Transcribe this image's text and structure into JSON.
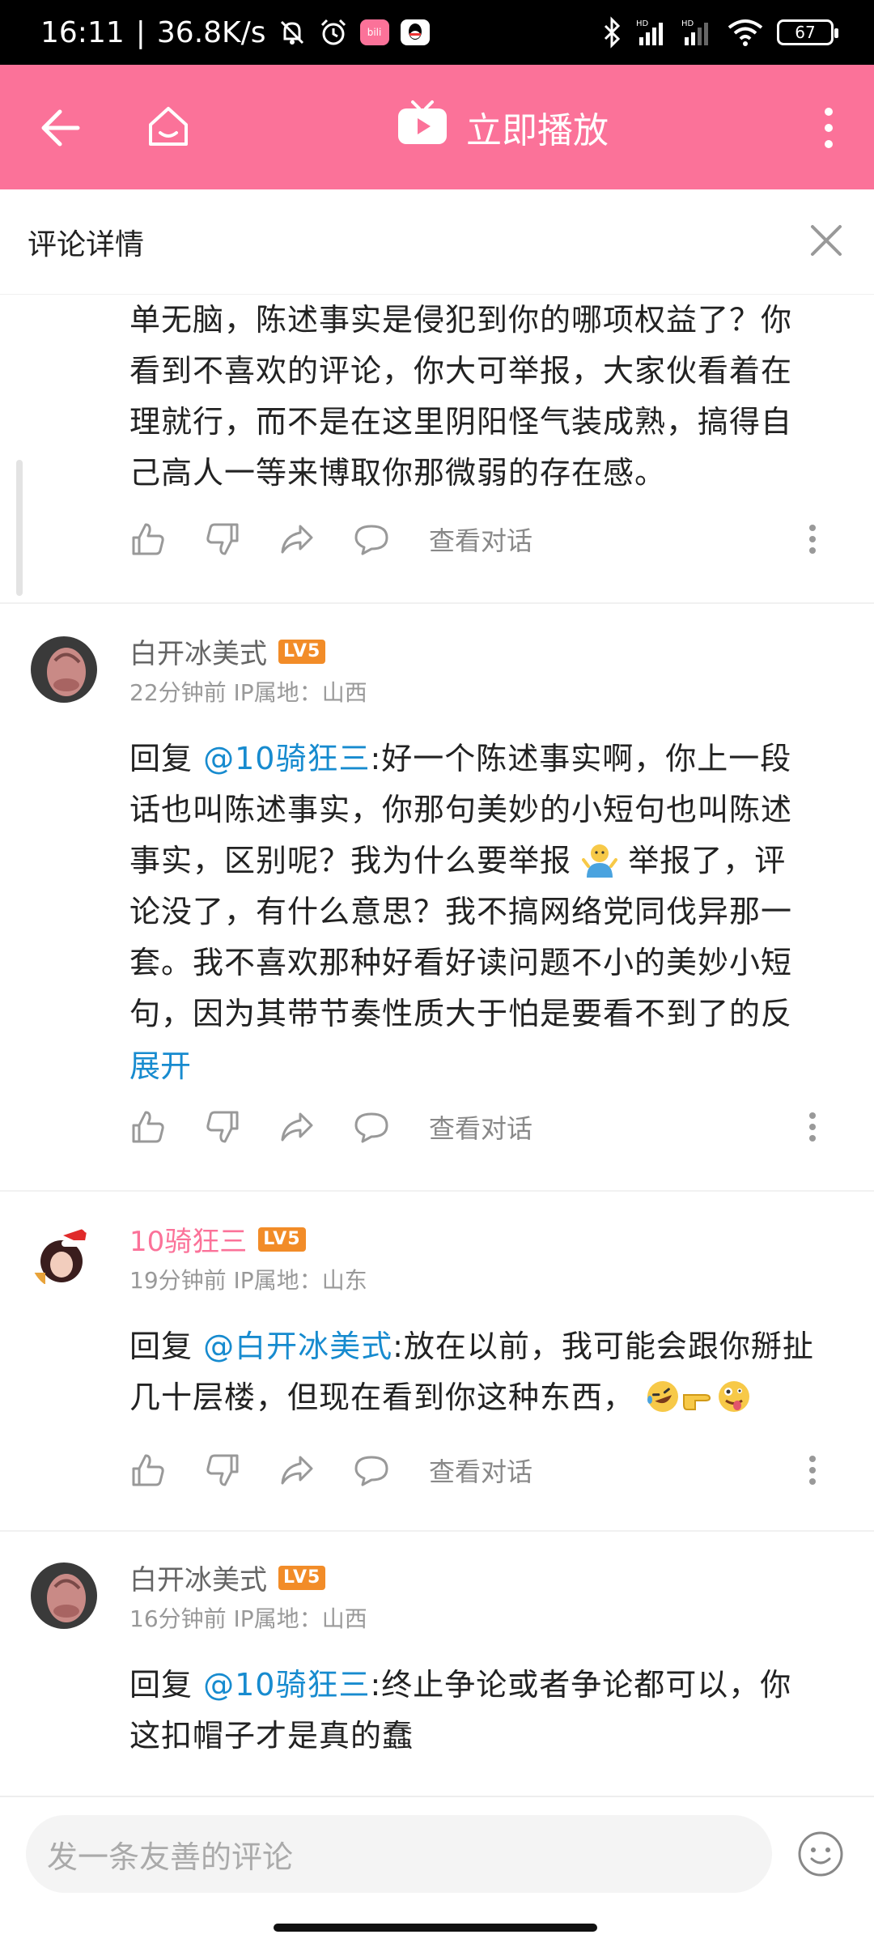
{
  "status_bar": {
    "time": "16:11",
    "separator": "|",
    "net_speed": "36.8K/s",
    "battery": "67",
    "icons": [
      "mute-bell-icon",
      "alarm-icon",
      "bilibili-app-icon",
      "qq-app-icon",
      "bluetooth-icon",
      "signal-hd-icon",
      "signal-hd-icon",
      "wifi-icon",
      "battery-icon"
    ]
  },
  "top_bar": {
    "play_label": "立即播放",
    "background": "#fb7299"
  },
  "panel": {
    "title": "评论详情"
  },
  "actions": {
    "view_conversation": "查看对话"
  },
  "comments": [
    {
      "partial": true,
      "lines": [
        "单无脑，陈述事实是侵犯到你的哪项权益了？你",
        "看到不喜欢的评论，你大可举报，大家伙看着在",
        "理就行，而不是在这里阴阳怪气装成熟，搞得自",
        "己高人一等来博取你那微弱的存在感。"
      ]
    },
    {
      "username": "白开冰美式",
      "level": "LV5",
      "time": "22分钟前",
      "ip": "IP属地：山西",
      "reply_prefix": "回复 ",
      "mention": "@10骑狂三",
      "lines": [
        ":好一个陈述事实啊，你上一段",
        "话也叫陈述事实，你那句美妙的小短句也叫陈述",
        "事实，区别呢？我为什么要举报",
        "举报了，评",
        "论没了，有什么意思？我不搞网络党同伐异那一",
        "套。我不喜欢那种好看好读问题不小的美妙小短",
        "句，因为其带节奏性质大于怕是要看不到了的反"
      ],
      "expand": "展开"
    },
    {
      "username": "10骑狂三",
      "level": "LV5",
      "time": "19分钟前",
      "ip": "IP属地：山东",
      "reply_prefix": "回复 ",
      "mention": "@白开冰美式",
      "lines": [
        ":放在以前，我可能会跟你掰扯",
        "几十层楼，但现在看到你这种东西，"
      ]
    },
    {
      "username": "白开冰美式",
      "level": "LV5",
      "time": "16分钟前",
      "ip": "IP属地：山西",
      "reply_prefix": "回复 ",
      "mention": "@10骑狂三",
      "lines": [
        ":终止争论或者争论都可以，你",
        "这扣帽子才是真的蠢"
      ]
    }
  ],
  "bottom_bar": {
    "input_placeholder": "发一条友善的评论"
  },
  "colors": {
    "accent_pink": "#fb7299",
    "link_blue": "#178bcf",
    "level_orange": "#f28c28"
  }
}
